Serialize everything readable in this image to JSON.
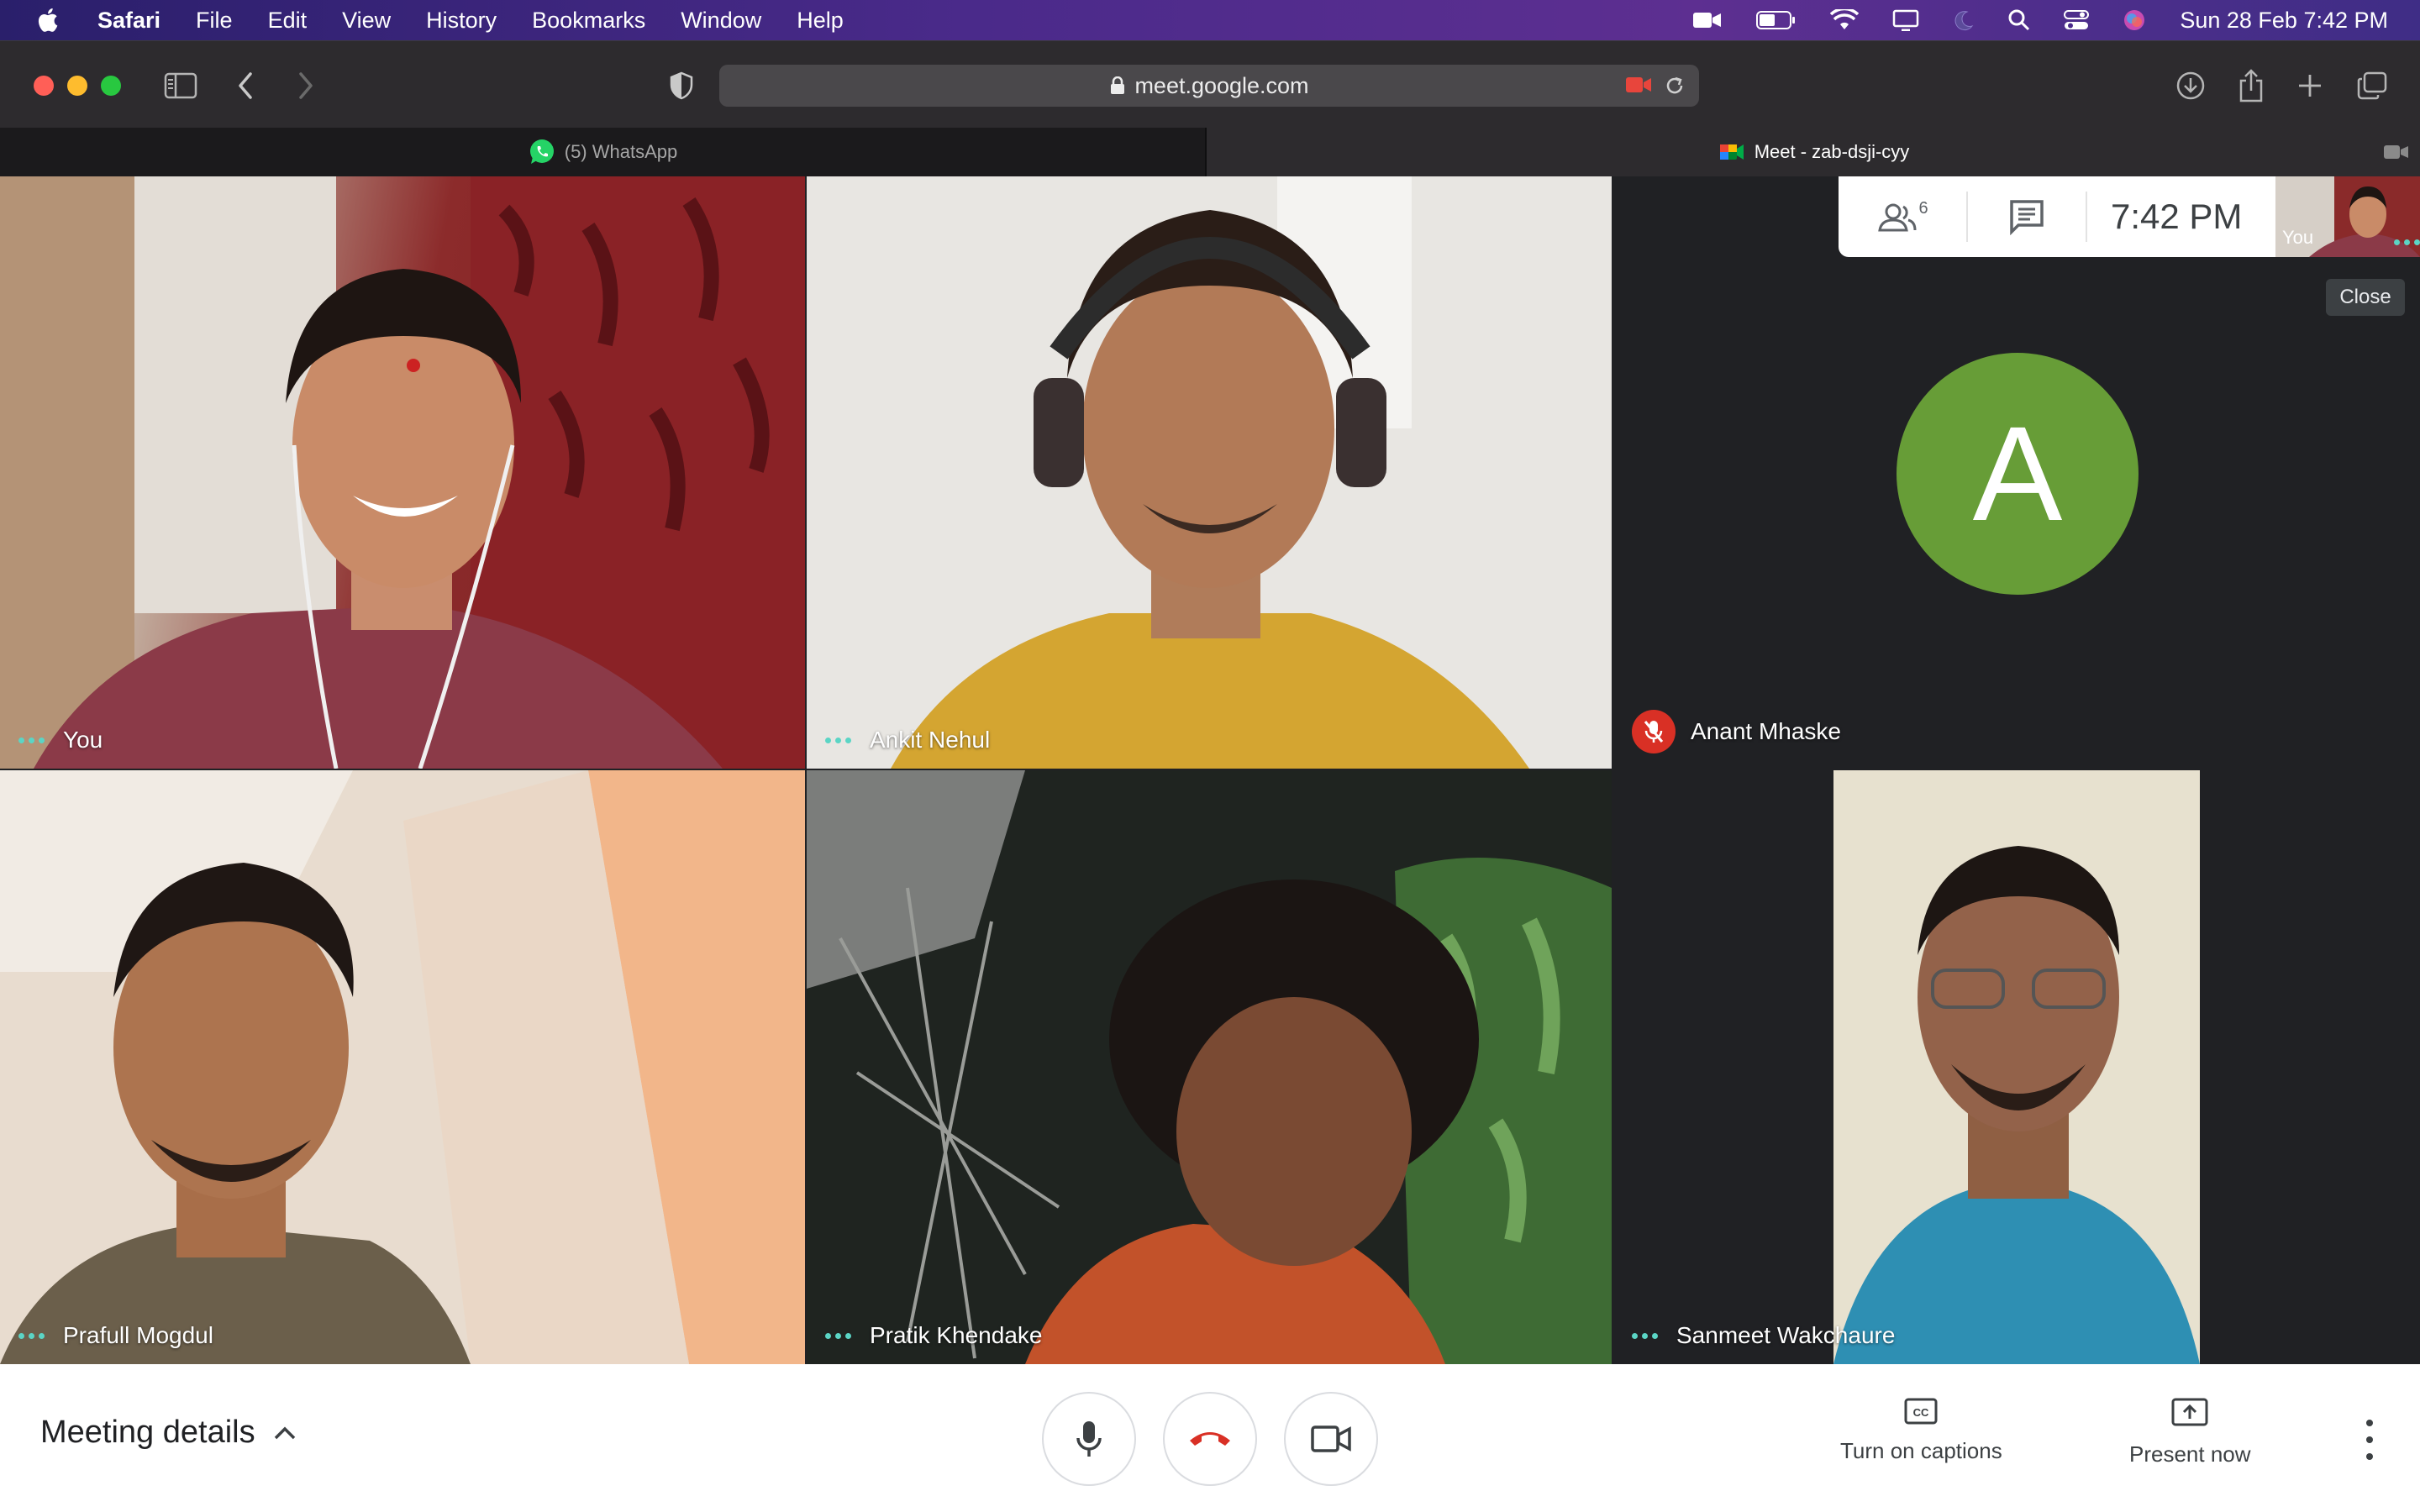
{
  "menubar": {
    "app_name": "Safari",
    "items": [
      "File",
      "Edit",
      "View",
      "History",
      "Bookmarks",
      "Window",
      "Help"
    ],
    "datetime": "Sun 28 Feb  7:42 PM",
    "status_icons": [
      "facetime-icon",
      "battery-icon",
      "wifi-icon",
      "screen-mirror-icon",
      "moon-icon",
      "search-icon",
      "control-center-icon",
      "siri-icon"
    ]
  },
  "browser": {
    "url": "meet.google.com",
    "tabs": [
      {
        "label": "(5) WhatsApp",
        "icon": "whatsapp-icon",
        "active": false
      },
      {
        "label": "Meet - zab-dsji-cyy",
        "icon": "google-meet-icon",
        "active": true
      }
    ]
  },
  "meet": {
    "participant_count": "6",
    "clock": "7:42 PM",
    "self_label": "You",
    "close_label": "Close",
    "participants": [
      {
        "name": "You",
        "muted": false
      },
      {
        "name": "Ankit Nehul",
        "muted": false
      },
      {
        "name": "Anant Mhaske",
        "muted": true,
        "avatar_letter": "A",
        "avatar_color": "#679d37"
      },
      {
        "name": "Prafull Mogdul",
        "muted": false
      },
      {
        "name": "Pratik Khendake",
        "muted": false
      },
      {
        "name": "Sanmeet Wakchaure",
        "muted": false
      }
    ]
  },
  "bottombar": {
    "meeting_details": "Meeting details",
    "captions_label": "Turn on captions",
    "present_label": "Present now",
    "hangup_color": "#d93025"
  },
  "colors": {
    "accent_dots": "#5bd5c5",
    "mute_red": "#d93025",
    "dark_bg": "#202124"
  }
}
